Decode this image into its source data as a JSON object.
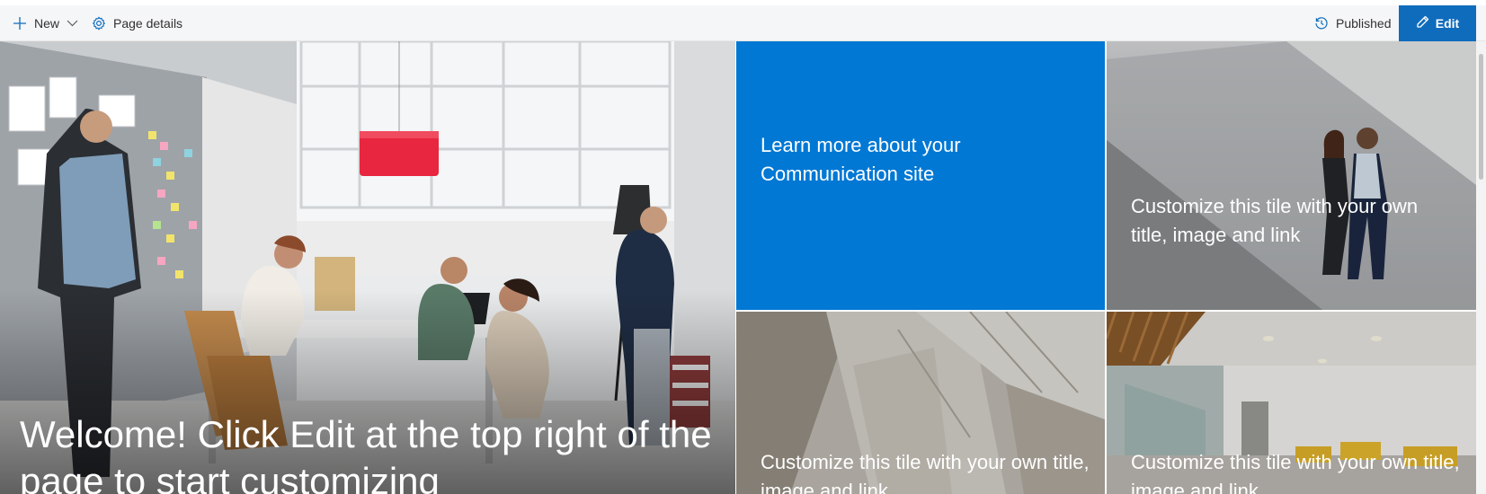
{
  "command_bar": {
    "new_label": "New",
    "page_details_label": "Page details",
    "published_label": "Published",
    "edit_label": "Edit",
    "icons": [
      "plus-icon",
      "chevron-down-icon",
      "gear-icon",
      "history-icon",
      "pencil-icon"
    ]
  },
  "hero": {
    "main_tile": {
      "title": "Welcome! Click Edit at the top right of the page to start customizing"
    },
    "tiles": [
      {
        "title": "Learn more about your Communication site"
      },
      {
        "title": "Customize this tile with your own title, image and link"
      },
      {
        "title": "Customize this tile with your own title, image and link"
      },
      {
        "title": "Customize this tile with your own title, image and link"
      }
    ]
  },
  "colors": {
    "accent": "#0f6cbd",
    "tile_blue": "#0078d4",
    "command_bar_bg": "#f5f6f8",
    "lamp_red": "#e8263f"
  }
}
